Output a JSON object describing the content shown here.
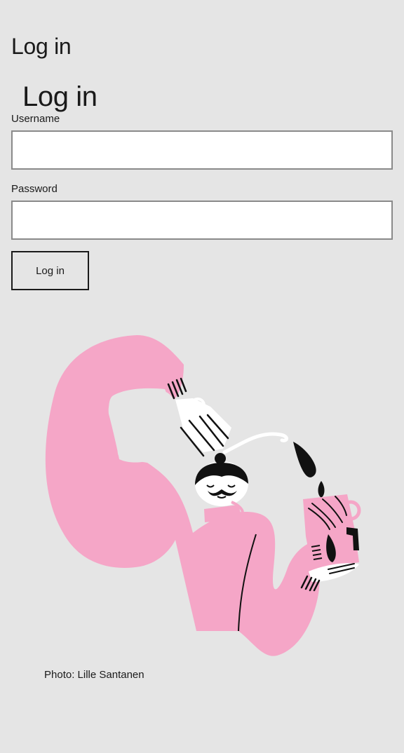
{
  "page": {
    "title": "Log in"
  },
  "form": {
    "title": "Log in",
    "username_label": "Username",
    "username_value": "",
    "password_label": "Password",
    "password_value": "",
    "submit_label": "Log in"
  },
  "illustration": {
    "caption": "Photo: Lille Santanen",
    "colors": {
      "body": "#f5a6c7",
      "ink": "#111111",
      "highlight": "#ffffff",
      "background": "#e5e5e5"
    }
  }
}
